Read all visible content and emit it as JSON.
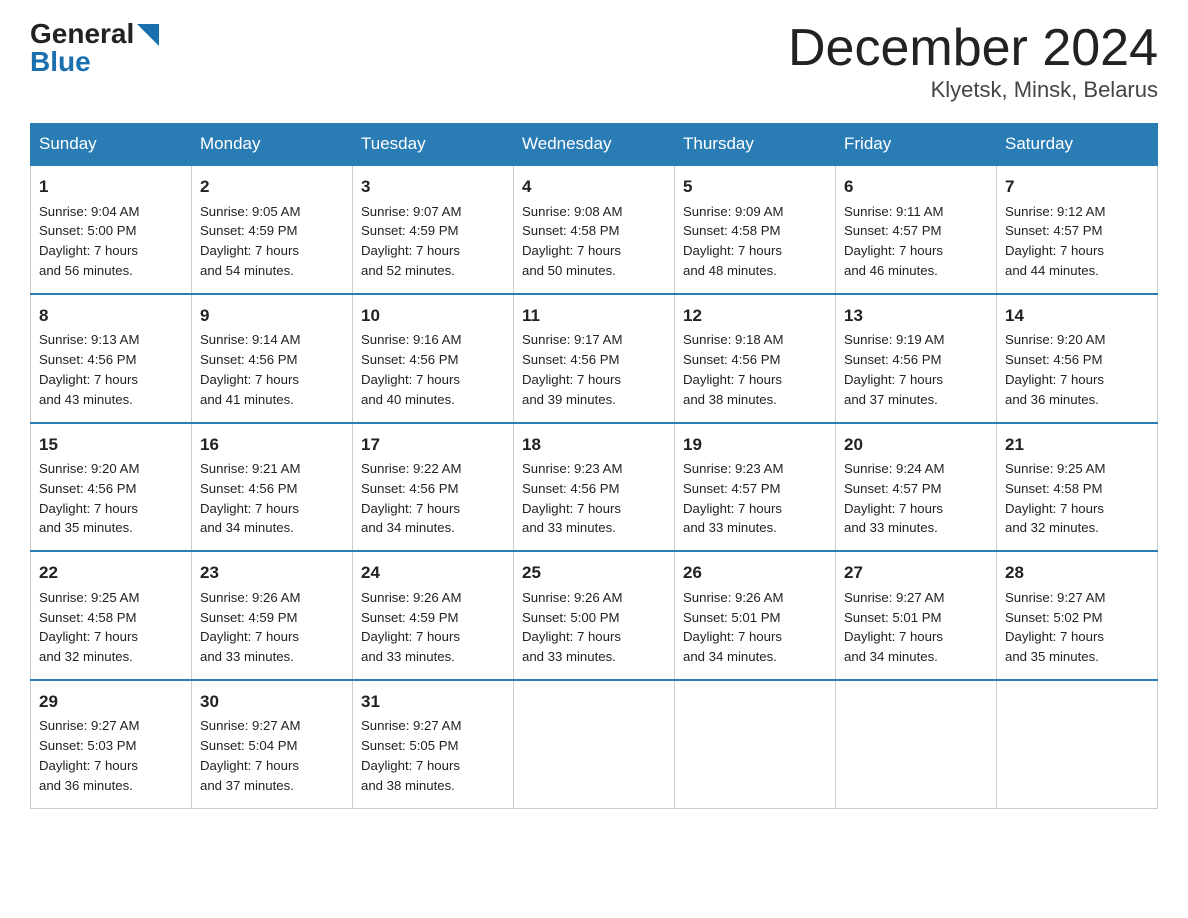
{
  "header": {
    "logo_general": "General",
    "logo_blue": "Blue",
    "month_title": "December 2024",
    "location": "Klyetsk, Minsk, Belarus"
  },
  "weekdays": [
    "Sunday",
    "Monday",
    "Tuesday",
    "Wednesday",
    "Thursday",
    "Friday",
    "Saturday"
  ],
  "weeks": [
    [
      {
        "day": "1",
        "sunrise": "9:04 AM",
        "sunset": "5:00 PM",
        "daylight": "7 hours and 56 minutes."
      },
      {
        "day": "2",
        "sunrise": "9:05 AM",
        "sunset": "4:59 PM",
        "daylight": "7 hours and 54 minutes."
      },
      {
        "day": "3",
        "sunrise": "9:07 AM",
        "sunset": "4:59 PM",
        "daylight": "7 hours and 52 minutes."
      },
      {
        "day": "4",
        "sunrise": "9:08 AM",
        "sunset": "4:58 PM",
        "daylight": "7 hours and 50 minutes."
      },
      {
        "day": "5",
        "sunrise": "9:09 AM",
        "sunset": "4:58 PM",
        "daylight": "7 hours and 48 minutes."
      },
      {
        "day": "6",
        "sunrise": "9:11 AM",
        "sunset": "4:57 PM",
        "daylight": "7 hours and 46 minutes."
      },
      {
        "day": "7",
        "sunrise": "9:12 AM",
        "sunset": "4:57 PM",
        "daylight": "7 hours and 44 minutes."
      }
    ],
    [
      {
        "day": "8",
        "sunrise": "9:13 AM",
        "sunset": "4:56 PM",
        "daylight": "7 hours and 43 minutes."
      },
      {
        "day": "9",
        "sunrise": "9:14 AM",
        "sunset": "4:56 PM",
        "daylight": "7 hours and 41 minutes."
      },
      {
        "day": "10",
        "sunrise": "9:16 AM",
        "sunset": "4:56 PM",
        "daylight": "7 hours and 40 minutes."
      },
      {
        "day": "11",
        "sunrise": "9:17 AM",
        "sunset": "4:56 PM",
        "daylight": "7 hours and 39 minutes."
      },
      {
        "day": "12",
        "sunrise": "9:18 AM",
        "sunset": "4:56 PM",
        "daylight": "7 hours and 38 minutes."
      },
      {
        "day": "13",
        "sunrise": "9:19 AM",
        "sunset": "4:56 PM",
        "daylight": "7 hours and 37 minutes."
      },
      {
        "day": "14",
        "sunrise": "9:20 AM",
        "sunset": "4:56 PM",
        "daylight": "7 hours and 36 minutes."
      }
    ],
    [
      {
        "day": "15",
        "sunrise": "9:20 AM",
        "sunset": "4:56 PM",
        "daylight": "7 hours and 35 minutes."
      },
      {
        "day": "16",
        "sunrise": "9:21 AM",
        "sunset": "4:56 PM",
        "daylight": "7 hours and 34 minutes."
      },
      {
        "day": "17",
        "sunrise": "9:22 AM",
        "sunset": "4:56 PM",
        "daylight": "7 hours and 34 minutes."
      },
      {
        "day": "18",
        "sunrise": "9:23 AM",
        "sunset": "4:56 PM",
        "daylight": "7 hours and 33 minutes."
      },
      {
        "day": "19",
        "sunrise": "9:23 AM",
        "sunset": "4:57 PM",
        "daylight": "7 hours and 33 minutes."
      },
      {
        "day": "20",
        "sunrise": "9:24 AM",
        "sunset": "4:57 PM",
        "daylight": "7 hours and 33 minutes."
      },
      {
        "day": "21",
        "sunrise": "9:25 AM",
        "sunset": "4:58 PM",
        "daylight": "7 hours and 32 minutes."
      }
    ],
    [
      {
        "day": "22",
        "sunrise": "9:25 AM",
        "sunset": "4:58 PM",
        "daylight": "7 hours and 32 minutes."
      },
      {
        "day": "23",
        "sunrise": "9:26 AM",
        "sunset": "4:59 PM",
        "daylight": "7 hours and 33 minutes."
      },
      {
        "day": "24",
        "sunrise": "9:26 AM",
        "sunset": "4:59 PM",
        "daylight": "7 hours and 33 minutes."
      },
      {
        "day": "25",
        "sunrise": "9:26 AM",
        "sunset": "5:00 PM",
        "daylight": "7 hours and 33 minutes."
      },
      {
        "day": "26",
        "sunrise": "9:26 AM",
        "sunset": "5:01 PM",
        "daylight": "7 hours and 34 minutes."
      },
      {
        "day": "27",
        "sunrise": "9:27 AM",
        "sunset": "5:01 PM",
        "daylight": "7 hours and 34 minutes."
      },
      {
        "day": "28",
        "sunrise": "9:27 AM",
        "sunset": "5:02 PM",
        "daylight": "7 hours and 35 minutes."
      }
    ],
    [
      {
        "day": "29",
        "sunrise": "9:27 AM",
        "sunset": "5:03 PM",
        "daylight": "7 hours and 36 minutes."
      },
      {
        "day": "30",
        "sunrise": "9:27 AM",
        "sunset": "5:04 PM",
        "daylight": "7 hours and 37 minutes."
      },
      {
        "day": "31",
        "sunrise": "9:27 AM",
        "sunset": "5:05 PM",
        "daylight": "7 hours and 38 minutes."
      },
      null,
      null,
      null,
      null
    ]
  ],
  "labels": {
    "sunrise": "Sunrise:",
    "sunset": "Sunset:",
    "daylight": "Daylight:"
  }
}
